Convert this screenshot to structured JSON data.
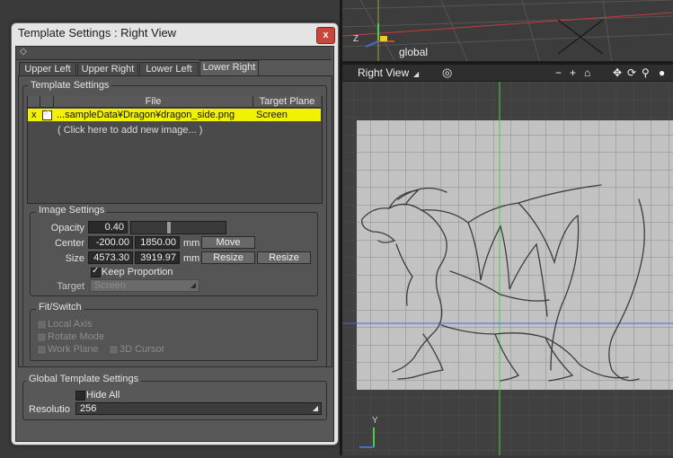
{
  "dialog": {
    "title": "Template Settings : Right View",
    "close_label": "x",
    "collapse_icon": "collapse-toggle-icon"
  },
  "tabs": [
    {
      "label": "Upper Left",
      "active": false
    },
    {
      "label": "Upper Right",
      "active": false
    },
    {
      "label": "Lower Left",
      "active": false
    },
    {
      "label": "Lower Right",
      "active": true
    }
  ],
  "template_settings": {
    "group_label": "Template Settings",
    "columns": {
      "file": "File",
      "target": "Target Plane"
    },
    "rows": [
      {
        "mark": "x",
        "checked": true,
        "file": "...sampleData¥Dragon¥dragon_side.png",
        "target": "Screen"
      }
    ],
    "add_row_text": "( Click here to add new image... )"
  },
  "image_settings": {
    "group_label": "Image Settings",
    "opacity_label": "Opacity",
    "opacity_value": "0.40",
    "opacity_level": 0.4,
    "center_label": "Center",
    "center_x": "-200.00",
    "center_y": "1850.00",
    "center_unit": "mm",
    "move_label": "Move",
    "size_label": "Size",
    "size_x": "4573.30",
    "size_y": "3919.97",
    "size_unit": "mm",
    "resize1_label": "Resize",
    "resize2_label": "Resize",
    "keep_proportion_label": "Keep Proportion",
    "target_label": "Target",
    "target_value": "Screen"
  },
  "fit_switch": {
    "group_label": "Fit/Switch",
    "local_axis": "Local Axis",
    "rotate_mode": "Rotate Mode",
    "work_plane": "Work Plane",
    "cursor_3d": "3D Cursor"
  },
  "global_settings": {
    "group_label": "Global Template Settings",
    "hide_all_label": "Hide All",
    "resolution_label": "Resolutio",
    "resolution_value": "256"
  },
  "viewport": {
    "title": "Right View",
    "top_axis_label": "global",
    "axis_z": "Z",
    "axis_x": "X",
    "axis_y": "Y",
    "tools": [
      "−",
      "+",
      "⌂",
      "✥",
      "⟳",
      "⚲",
      "●"
    ]
  },
  "colors": {
    "selected_row": "#f2f200",
    "close_button": "#c8463a",
    "axis_green": "#4ccd4c",
    "axis_red": "#d84040"
  }
}
